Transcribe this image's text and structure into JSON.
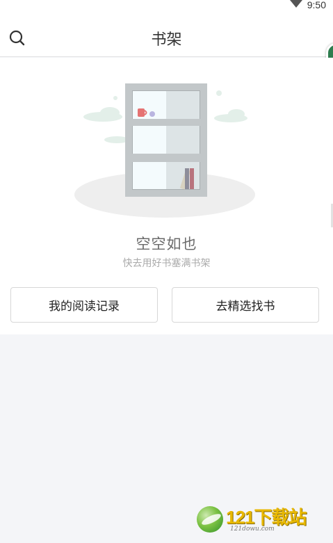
{
  "status_bar": {
    "time": "9:50",
    "wifi_icon": "wifi-icon"
  },
  "header": {
    "title": "书架",
    "search_icon": "search-icon"
  },
  "empty_state": {
    "illustration_icon": "empty-bookshelf-illustration",
    "title": "空空如也",
    "subtitle": "快去用好书塞满书架"
  },
  "actions": {
    "history_label": "我的阅读记录",
    "store_label": "去精选找书"
  },
  "watermark": {
    "brand": "121下载站",
    "url": "121dowu.com"
  }
}
